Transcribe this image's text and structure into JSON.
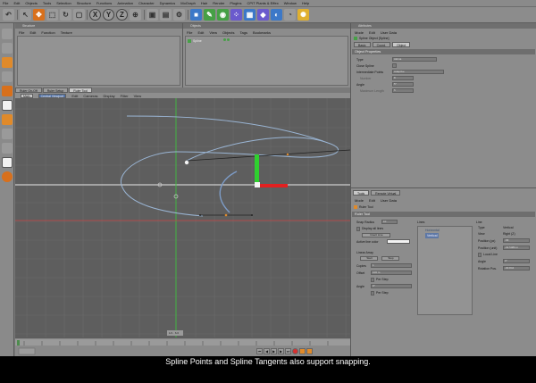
{
  "menubar": {
    "items": [
      "File",
      "Edit",
      "Objects",
      "Tools",
      "Selection",
      "Structure",
      "Functions",
      "Animation",
      "Character",
      "Dynamics",
      "MoGraph",
      "Hair",
      "Render",
      "Plugins",
      "CPIT Plants & Effex",
      "Window",
      "Help"
    ]
  },
  "structure_panel": {
    "title": "Structure",
    "menu": [
      "File",
      "Edit",
      "Function",
      "Texture"
    ]
  },
  "object_manager": {
    "title": "Objects",
    "menu": [
      "File",
      "Edit",
      "View",
      "Objects",
      "Tags",
      "Bookmarks"
    ],
    "object_name": "Spline"
  },
  "viewport_tabs": [
    "Ruler On-Off",
    "Ruler Setup",
    "Ruler Tool"
  ],
  "viewport": {
    "mode_tab": "Main",
    "camera_label": "Central Viewport",
    "menu": [
      "Edit",
      "Cameras",
      "Display",
      "Filter",
      "View"
    ],
    "bottom_label": "1/1 · 6.6"
  },
  "attributes": {
    "title": "Attributes",
    "menu": [
      "Mode",
      "Edit",
      "User Data"
    ],
    "object_label": "Spline Object [Spline]",
    "tabs": [
      "Basic",
      "Coord.",
      "Object"
    ],
    "section": "Object Properties",
    "props": [
      {
        "label": "Type",
        "value": "Akima"
      },
      {
        "label": "Close Spline",
        "value": ""
      },
      {
        "label": "Intermediate Points",
        "value": "Adaptive"
      },
      {
        "label": "Number",
        "value": "8"
      },
      {
        "label": "Angle",
        "value": "5°"
      },
      {
        "label": "Maximum Length",
        "value": "5"
      }
    ]
  },
  "tool_panel": {
    "tabs": [
      "Tools",
      "Remote Virtual"
    ],
    "menu": [
      "Mode",
      "Edit",
      "User Data"
    ],
    "tool_label": "Ruler Tool",
    "section": "Ruler Tool",
    "snap_radius_label": "Snap Radius",
    "snap_radius_value": "10",
    "display_all_lines": "Display all lines",
    "insert_line": "Insert Line",
    "active_line_color": "Active line color",
    "linear_array": "Linear Array",
    "array_buttons": [
      "Start",
      "Stop"
    ],
    "copies_label": "Copies",
    "copies_value": "1",
    "offset_label": "Offset",
    "offset_value": "100 m",
    "per_step_1": "Per Step",
    "angle_label": "Angle",
    "angle_value": "0°",
    "per_step_2": "Per Step",
    "lines_label": "Lines",
    "lines_items": [
      "Horizontal",
      "Vertical"
    ],
    "line_label": "Line",
    "line_props": [
      {
        "label": "Type",
        "value": "Vertical"
      },
      {
        "label": "View",
        "value": "Right (Z)"
      },
      {
        "label": "Position (px)",
        "value": "-58"
      },
      {
        "label": "Position (unit)",
        "value": "-32.5089 m"
      },
      {
        "label": "Local Line",
        "value": ""
      },
      {
        "label": "Angle",
        "value": "0°"
      },
      {
        "label": "Rotation Pos.",
        "value": "-30.844"
      }
    ]
  },
  "subtitle": "Spline Points and Spline Tangents also support snapping.",
  "colors": {
    "viewport_bg": "#5e5e5e",
    "grid": "#6a6a6a",
    "spline": "#9ab5d4",
    "axis_green": "#2fd02f",
    "axis_red": "#e22020",
    "guide_red": "#c84545",
    "ruler_orange": "#e08a2a"
  }
}
